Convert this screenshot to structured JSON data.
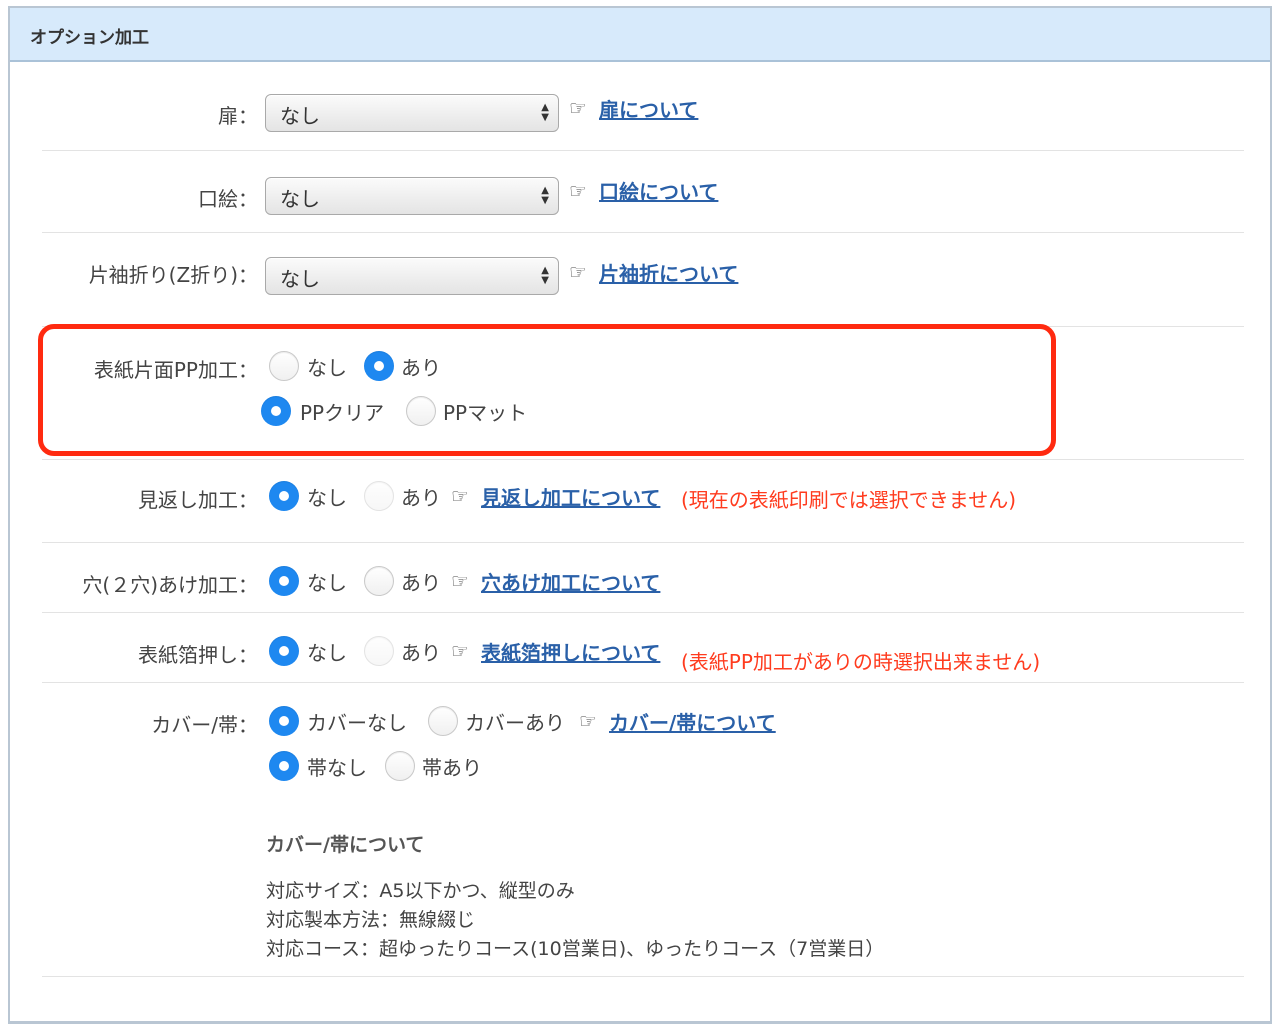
{
  "section": {
    "title": "オプション加工"
  },
  "rows": {
    "tobira": {
      "label": "扉：",
      "select_value": "なし",
      "link": "扉について"
    },
    "kuchie": {
      "label": "口絵：",
      "select_value": "なし",
      "link": "口絵について"
    },
    "katasode": {
      "label": "片袖折り(Z折り)：",
      "select_value": "なし",
      "link": "片袖折について"
    },
    "pp": {
      "label": "表紙片面PP加工：",
      "options": [
        "なし",
        "あり"
      ],
      "selected": "あり",
      "sub_options": [
        "PPクリア",
        "PPマット"
      ],
      "sub_selected": "PPクリア"
    },
    "mikaeshi": {
      "label": "見返し加工：",
      "options": [
        "なし",
        "あり"
      ],
      "selected": "なし",
      "link": "見返し加工について",
      "warning": "(現在の表紙印刷では選択できません)"
    },
    "ana": {
      "label": "穴(２穴)あけ加工：",
      "options": [
        "なし",
        "あり"
      ],
      "selected": "なし",
      "link": "穴あけ加工について"
    },
    "hakuoshi": {
      "label": "表紙箔押し：",
      "options": [
        "なし",
        "あり"
      ],
      "selected": "なし",
      "link": "表紙箔押しについて",
      "warning": "(表紙PP加工がありの時選択出来ません)"
    },
    "cover": {
      "label": "カバー/帯：",
      "options": [
        "カバーなし",
        "カバーあり"
      ],
      "selected": "カバーなし",
      "link": "カバー/帯について",
      "sub_options": [
        "帯なし",
        "帯あり"
      ],
      "sub_selected": "帯なし"
    }
  },
  "note": {
    "title": "カバー/帯について",
    "lines": [
      "対応サイズ：A5以下かつ、縦型のみ",
      "対応製本方法：無線綴じ",
      "対応コース：超ゆったりコース(10営業日)、ゆったりコース（7営業日）"
    ]
  },
  "icons": {
    "hand": "pointing-hand-icon",
    "select_arrows": "up-down-arrows-icon"
  },
  "colors": {
    "header_bg": "#d7eafb",
    "radio_checked": "#1e88f0",
    "link": "#2a60a8",
    "warning": "#ff3b1e",
    "highlight": "#ff2a10"
  }
}
